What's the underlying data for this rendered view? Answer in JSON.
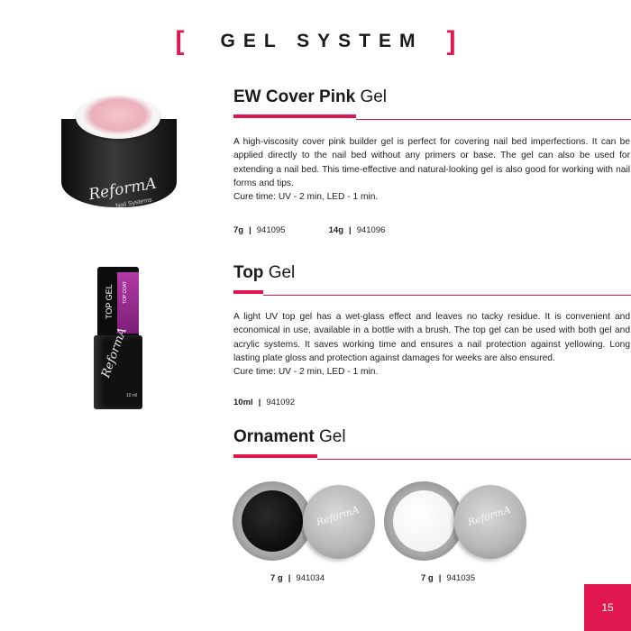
{
  "header": {
    "title": "GEL SYSTEM",
    "bracket_left": "[",
    "bracket_right": "]"
  },
  "colors": {
    "accent": "#e0174f",
    "text": "#1a1a1a"
  },
  "sections": [
    {
      "title_bold": "EW Cover Pink",
      "title_rest": "Gel",
      "description": "A high-viscosity cover pink builder gel is perfect for covering nail bed imperfections. It can be applied directly to the nail bed without any primers or base. The gel can also be used for extending a nail bed. This time-effective and natural-looking gel is also good for working with nail forms and tips.",
      "cure": "Cure time: UV - 2 min, LED - 1 min.",
      "variants": [
        {
          "size": "7g",
          "code": "941095"
        },
        {
          "size": "14g",
          "code": "941096"
        }
      ]
    },
    {
      "title_bold": "Top",
      "title_rest": "Gel",
      "description": "A light UV top gel has a wet-glass effect and leaves no tacky residue. It is convenient and economical in use, available in a bottle with a brush. The top gel can be used with both gel and acrylic systems. It saves working time and ensures a nail protection against yellowing. Long lasting plate gloss and protection against damages for weeks are also ensured.",
      "cure": "Cure time: UV - 2 min, LED - 1 min.",
      "variants": [
        {
          "size": "10ml",
          "code": "941092"
        }
      ]
    },
    {
      "title_bold": "Ornament",
      "title_rest": "Gel",
      "variants": [
        {
          "size": "7 g",
          "code": "941034"
        },
        {
          "size": "7 g",
          "code": "941035"
        }
      ]
    }
  ],
  "product_images": {
    "jar_brand": "ReformA",
    "jar_sub": "Nail Systems",
    "bottle_label": "TOP GEL",
    "bottle_sub": "TOP COAT",
    "bottle_volume": "10 ml",
    "pot_brand": "ReformA"
  },
  "page_number": "15"
}
